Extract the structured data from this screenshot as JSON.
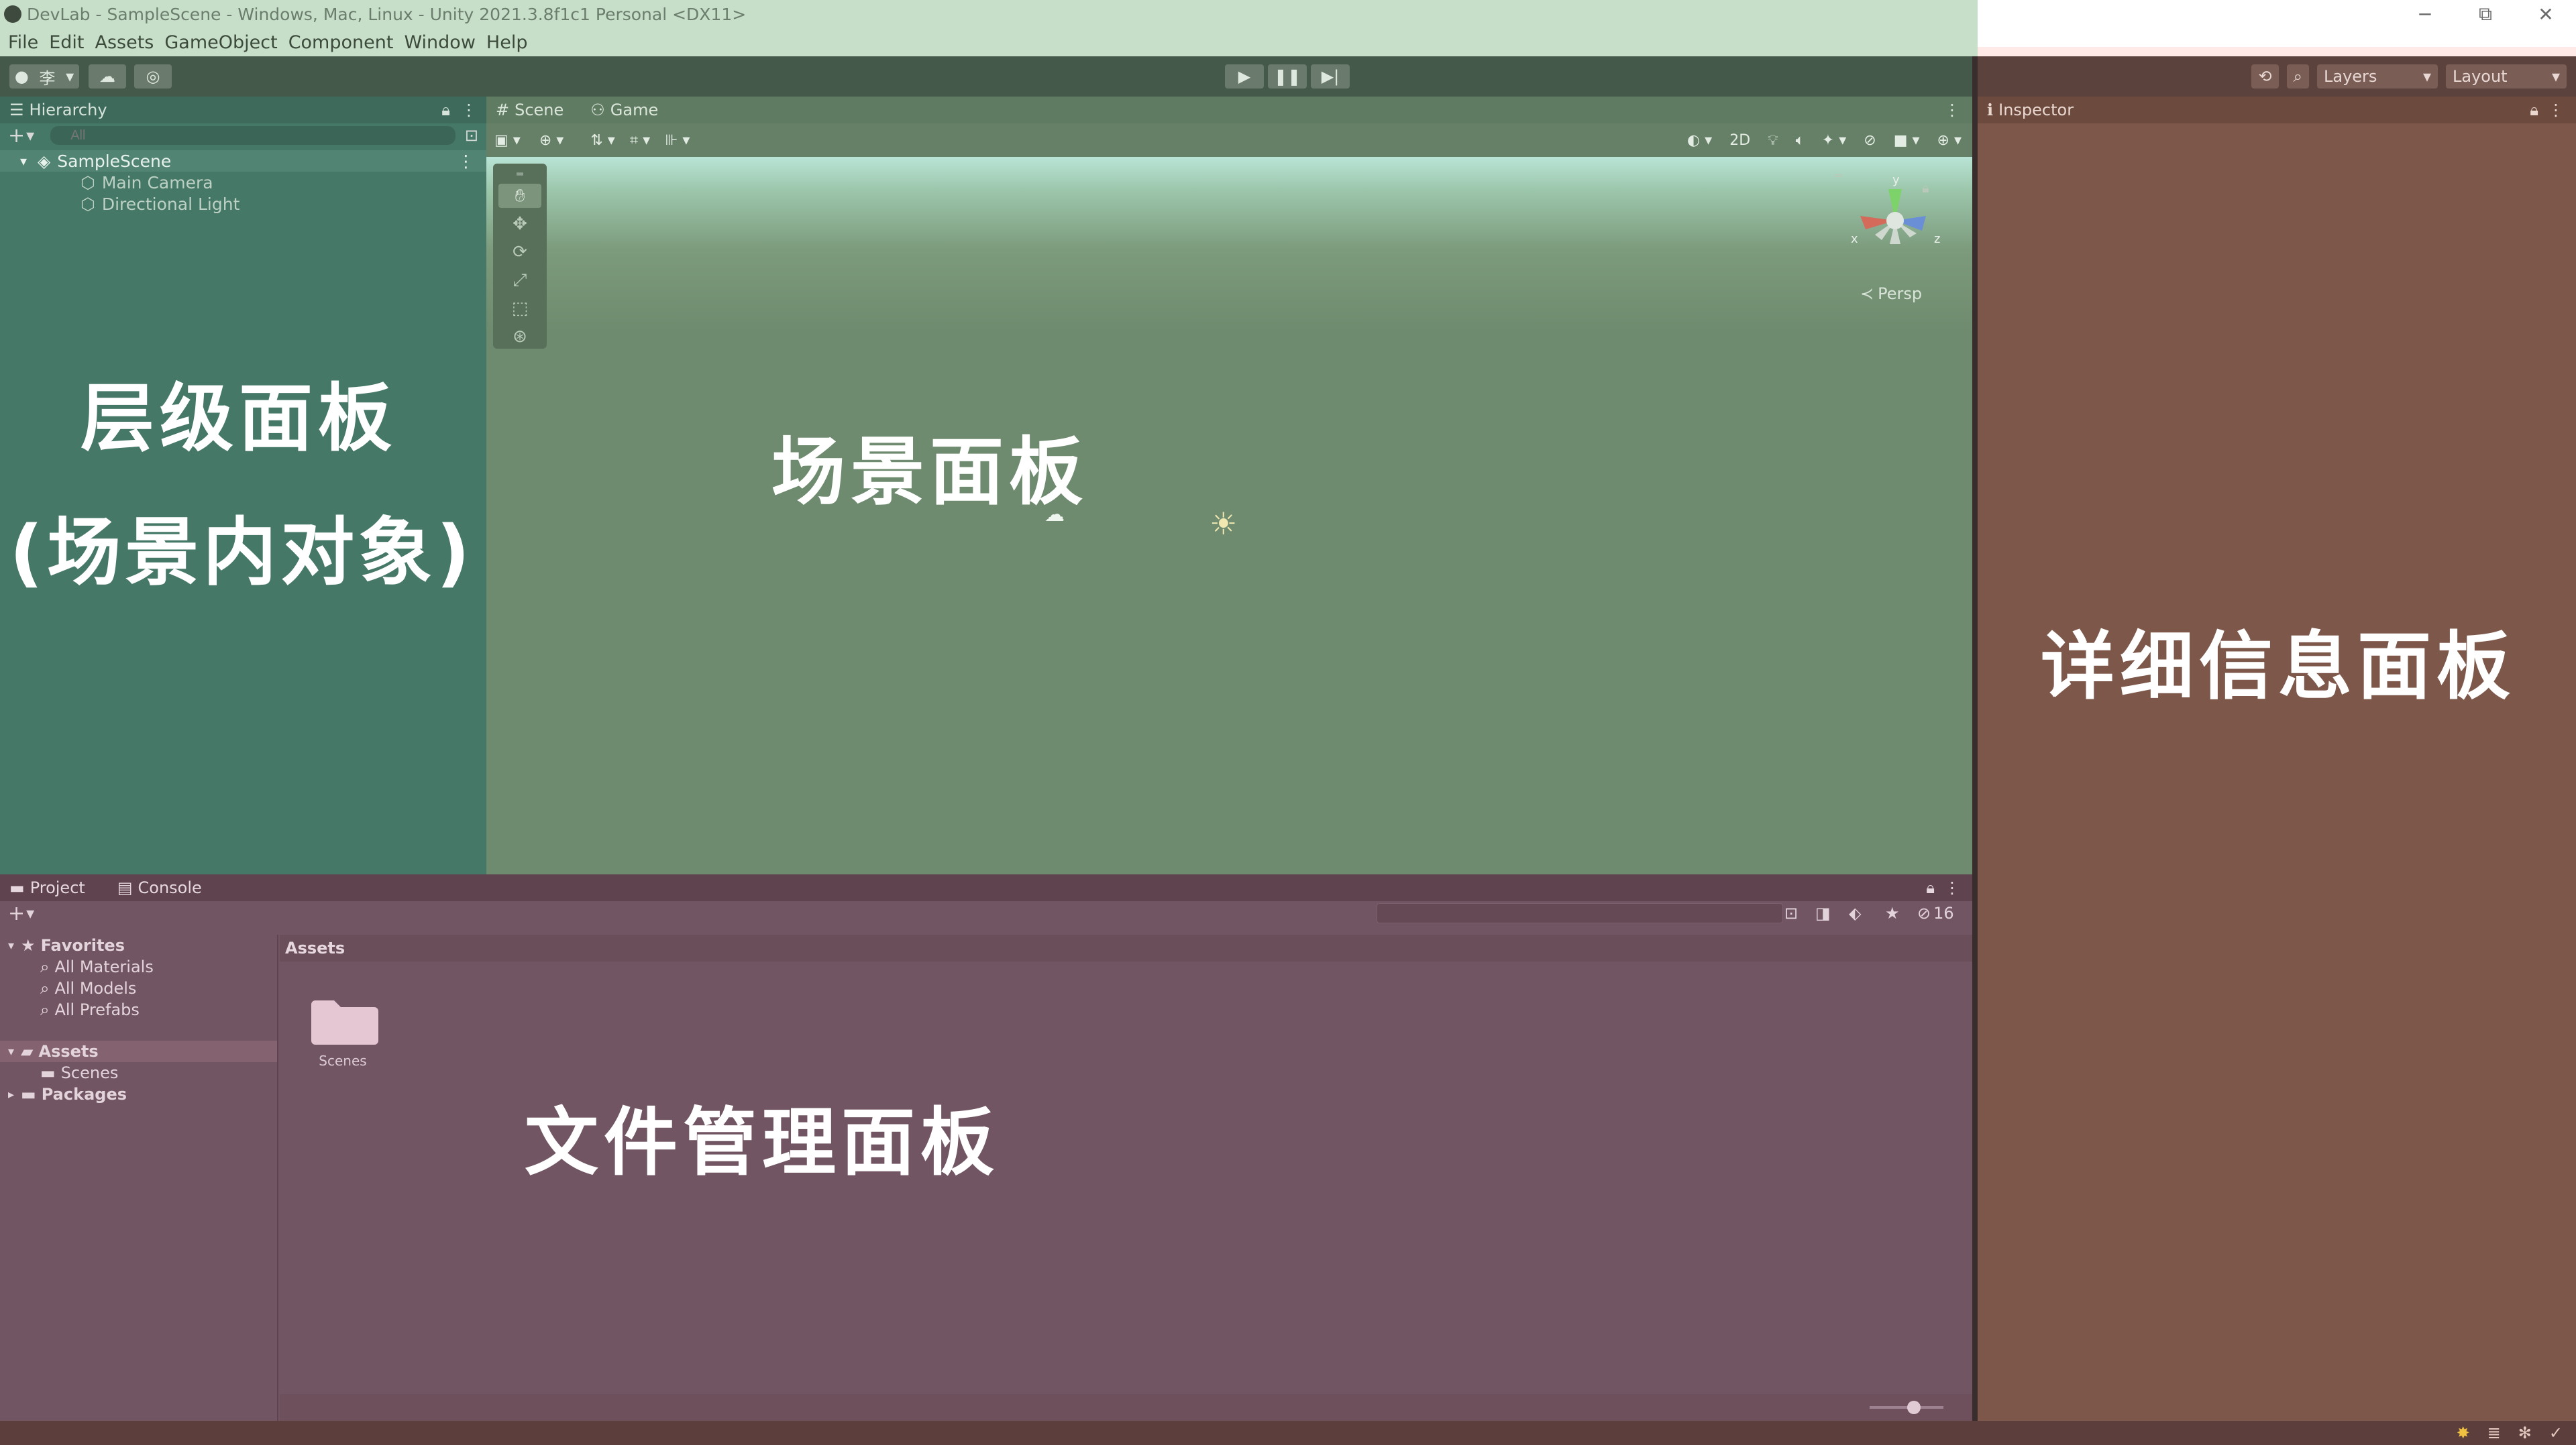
{
  "window": {
    "title": "DevLab - SampleScene - Windows, Mac, Linux - Unity 2021.3.8f1c1 Personal <DX11>",
    "minimize": "─",
    "restore": "⧉",
    "close": "✕"
  },
  "menu": [
    "File",
    "Edit",
    "Assets",
    "GameObject",
    "Component",
    "Window",
    "Help"
  ],
  "toolbar": {
    "account": "李",
    "layers": "Layers",
    "layout": "Layout"
  },
  "hierarchy": {
    "tab": "Hierarchy",
    "search_placeholder": "All",
    "scene": "SampleScene",
    "objects": [
      "Main Camera",
      "Directional Light"
    ]
  },
  "scene_view": {
    "tabs": [
      "Scene",
      "Game"
    ],
    "mode_2d": "2D",
    "persp": "Persp",
    "gizmo_axes": {
      "x": "x",
      "z": "z",
      "y": "y"
    }
  },
  "inspector": {
    "tab": "Inspector"
  },
  "project": {
    "tabs": [
      "Project",
      "Console"
    ],
    "favorites": {
      "label": "Favorites",
      "items": [
        "All Materials",
        "All Models",
        "All Prefabs"
      ]
    },
    "assets_label": "Assets",
    "assets_children": [
      "Scenes"
    ],
    "packages_label": "Packages",
    "breadcrumb": "Assets",
    "hidden_count": "16",
    "grid_items": [
      "Scenes"
    ]
  },
  "annotations": {
    "hierarchy_line1": "层级面板",
    "hierarchy_line2": "(场景内对象)",
    "scene": "场景面板",
    "inspector": "详细信息面板",
    "project": "文件管理面板"
  },
  "colors": {
    "hierarchy_overlay": "#457867",
    "scene_overlay": "#6f8b6f",
    "inspector_overlay": "#7d5749",
    "project_overlay": "#725562",
    "title_overlay": "#c7dfc8"
  }
}
